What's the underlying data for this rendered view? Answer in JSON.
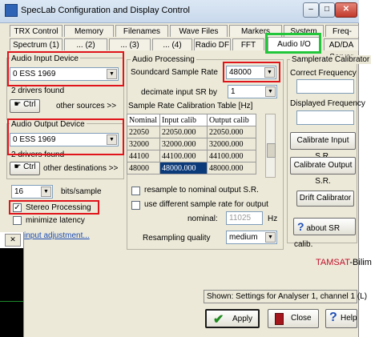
{
  "window": {
    "title": "SpecLab   Configuration and Display Control"
  },
  "title_buttons": {
    "minimize": "–",
    "maximize": "□",
    "close": "✕"
  },
  "tabs_row1": [
    "TRX Control",
    "Memory",
    "Filenames",
    "Wave Files",
    "Markers",
    "System",
    "Freq-Resp"
  ],
  "tabs_row2": [
    "Spectrum (1)",
    "... (2)",
    "... (3)",
    "... (4)",
    "Radio DF",
    "FFT",
    "Audio I/O",
    "AD/DA Server"
  ],
  "input_device": {
    "label": "Audio Input Device",
    "value": "0 ESS 1969",
    "drivers": "2 drivers found",
    "ctrl": "Ctrl",
    "other": "other sources >>"
  },
  "output_device": {
    "label": "Audio Output Device",
    "value": "0 ESS 1969",
    "drivers": "2 drivers found",
    "ctrl": "Ctrl",
    "other": "other destinations >>"
  },
  "bits": {
    "value": "16",
    "label": "bits/sample"
  },
  "stereo": {
    "label": "Stereo Processing",
    "checked": "✓"
  },
  "minimize_latency": {
    "label": "minimize latency"
  },
  "input_adjustment": "input adjustment...",
  "processing": {
    "label": "Audio Processing",
    "rate_label": "Soundcard Sample Rate",
    "rate_value": "48000",
    "decimate_label": "decimate input SR by",
    "decimate_value": "1",
    "table_title": "Sample Rate Calibration Table [Hz]",
    "table": {
      "headers": [
        "Nominal",
        "Input calib",
        "Output calib"
      ],
      "rows": [
        [
          "22050",
          "22050.000",
          "22050.000"
        ],
        [
          "32000",
          "32000.000",
          "32000.000"
        ],
        [
          "44100",
          "44100.000",
          "44100.000"
        ],
        [
          "48000",
          "48000.000",
          "48000.000"
        ]
      ]
    },
    "resample_label": "resample to nominal output S.R.",
    "different_label": "use different sample rate for output",
    "nominal_label": "nominal:",
    "nominal_value": "11025",
    "nominal_unit": "Hz",
    "quality_label": "Resampling quality",
    "quality_value": "medium"
  },
  "calibrator": {
    "label": "Samplerate Calibrator",
    "correct_label": "Correct Frequency",
    "displayed_label": "Displayed Frequency",
    "cal_input": "Calibrate Input S.R.",
    "cal_output": "Calibrate Output S.R.",
    "drift": "Drift Calibrator",
    "about": "about SR calib."
  },
  "brand": {
    "part1": "TAMSAT",
    "part2": "-Bilim"
  },
  "shown": "Shown: Settings for Analyser 1, channel 1 (L)",
  "buttons": {
    "apply": "Apply",
    "close": "Close",
    "help": "Help"
  },
  "colors": {
    "highlight_red": "#e0141b",
    "highlight_green": "#22c63a",
    "selection": "#0b3a7a",
    "brand_red": "#c0102a"
  }
}
